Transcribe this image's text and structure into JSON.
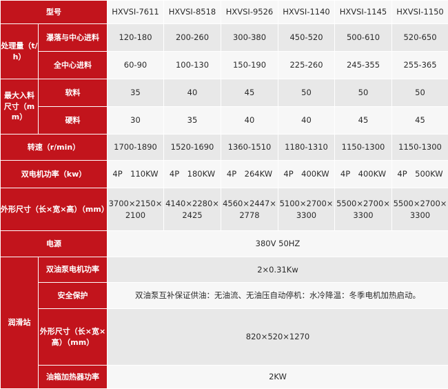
{
  "header": {
    "label": "型号",
    "models": [
      "HXVSI-7611",
      "HXVSI-8518",
      "HXVSI-9526",
      "HXVSI-1140",
      "HXVSI-1145",
      "HXVSI-1150"
    ]
  },
  "capacity": {
    "label": "处理量（t/h）",
    "cascade": {
      "label": "瀑落与中心进料",
      "values": [
        "120-180",
        "200-260",
        "300-380",
        "450-520",
        "500-610",
        "520-650"
      ]
    },
    "center": {
      "label": "全中心进料",
      "values": [
        "60-90",
        "100-130",
        "150-190",
        "225-260",
        "245-355",
        "255-365"
      ]
    }
  },
  "feed_size": {
    "label": "最大入料尺寸（mm）",
    "soft": {
      "label": "软料",
      "values": [
        "35",
        "40",
        "45",
        "50",
        "50",
        "50"
      ]
    },
    "hard": {
      "label": "硬料",
      "values": [
        "30",
        "35",
        "40",
        "40",
        "45",
        "45"
      ]
    }
  },
  "speed": {
    "label": "转速（r/min）",
    "values": [
      "1700-1890",
      "1520-1690",
      "1360-1510",
      "1180-1310",
      "1150-1300",
      "1150-1300"
    ]
  },
  "motor_power": {
    "label": "双电机功率（kw）",
    "values": [
      "4P　110KW",
      "4P　180KW",
      "4P　264KW",
      "4P　400KW",
      "4P　400KW",
      "4P　500KW"
    ]
  },
  "dimensions": {
    "label": "外形尺寸（长×宽×高）（mm）",
    "values": [
      "3700×2150×2100",
      "4140×2280×2425",
      "4560×2447×2778",
      "5100×2700×3300",
      "5500×2700×3300",
      "5500×2700×3300"
    ]
  },
  "power_supply": {
    "label": "电源",
    "value": "380V 50HZ"
  },
  "lubrication": {
    "label": "润滑站",
    "pump_power": {
      "label": "双油泵电机功率",
      "value": "2×0.31Kw"
    },
    "safety": {
      "label": "安全保护",
      "value": "双油泵互补保证供油：无油流、无油压自动停机：水冷降温：冬季电机加热启动。"
    },
    "dimensions": {
      "label": "外形尺寸（长×宽×高）（mm）",
      "value": "820×520×1270"
    },
    "heater": {
      "label": "油箱加热器功率",
      "value": "2KW"
    }
  }
}
